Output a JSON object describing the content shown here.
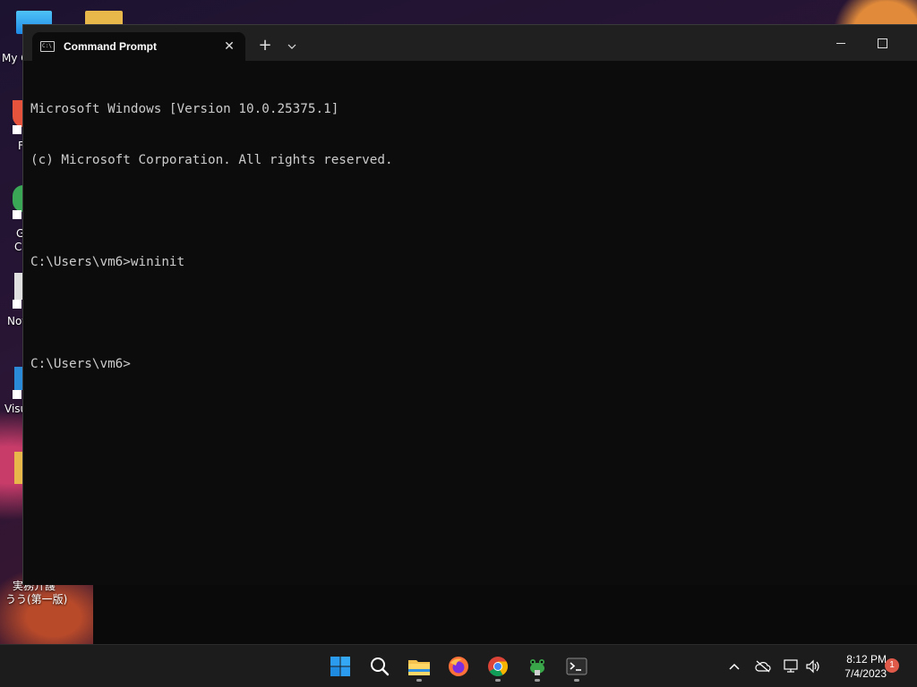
{
  "desktop": {
    "icons": [
      {
        "label": "My C"
      },
      {
        "label": "F"
      },
      {
        "label": "G"
      },
      {
        "label": "C"
      },
      {
        "label": "Not"
      },
      {
        "label": "Visu"
      },
      {
        "label": "実務介護"
      },
      {
        "label": "うう(第一版)"
      }
    ]
  },
  "window": {
    "tab_title": "Command Prompt",
    "tab_icon_text": "C:\\",
    "tab_close_glyph": "✕",
    "new_tab_glyph": "+",
    "dropdown_glyph": "⌄"
  },
  "console": {
    "lines": [
      "Microsoft Windows [Version 10.0.25375.1]",
      "(c) Microsoft Corporation. All rights reserved.",
      "",
      "C:\\Users\\vm6>wininit",
      "",
      "C:\\Users\\vm6>"
    ]
  },
  "taskbar": {
    "apps": [
      {
        "name": "start",
        "icon": "windows-logo-icon",
        "running": false
      },
      {
        "name": "search",
        "icon": "search-icon",
        "running": false
      },
      {
        "name": "file-explorer",
        "icon": "folder-icon",
        "running": true
      },
      {
        "name": "firefox",
        "icon": "firefox-icon",
        "running": false
      },
      {
        "name": "chrome",
        "icon": "chrome-icon",
        "running": true
      },
      {
        "name": "frog-app",
        "icon": "frog-icon",
        "running": true
      },
      {
        "name": "terminal",
        "icon": "terminal-icon",
        "running": true
      }
    ],
    "tray": {
      "time": "8:12 PM",
      "date": "7/4/2023",
      "notification_count": "1"
    }
  },
  "colors": {
    "console_bg": "#0c0c0c",
    "console_fg": "#cccccc",
    "titlebar_bg": "#202020",
    "taskbar_bg": "#1c1c1c",
    "notification_badge": "#e05a4a"
  }
}
